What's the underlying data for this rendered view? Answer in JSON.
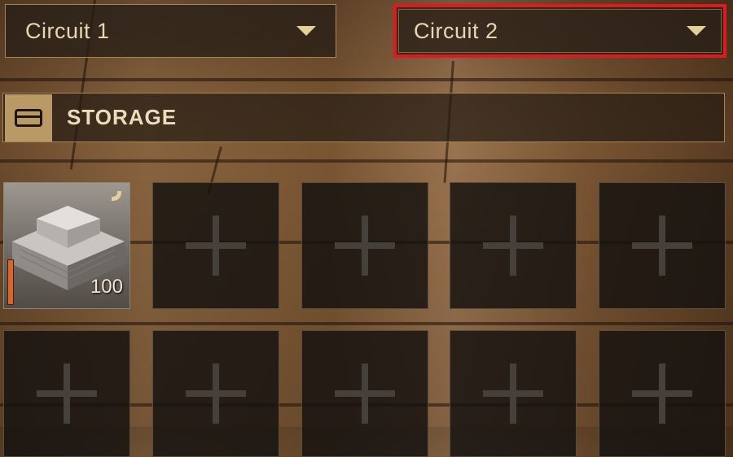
{
  "dropdowns": [
    {
      "label": "Circuit 1",
      "icon": "chevron-down-icon"
    },
    {
      "label": "Circuit 2",
      "icon": "chevron-down-icon",
      "highlight_color": "#e01820"
    }
  ],
  "storage": {
    "title": "STORAGE",
    "icon": "chest-icon",
    "slots_visible": 10,
    "items": [
      {
        "name": "stone foundation block",
        "icon": "stone-block-icon",
        "quantity": "100",
        "durability_color": "#d9652c"
      }
    ],
    "empty_slot_icon": "plus-icon"
  },
  "colors": {
    "accent": "#e3cf9a",
    "border": "#a48658",
    "text": "#e7d6b2",
    "highlight": "#e01820"
  }
}
